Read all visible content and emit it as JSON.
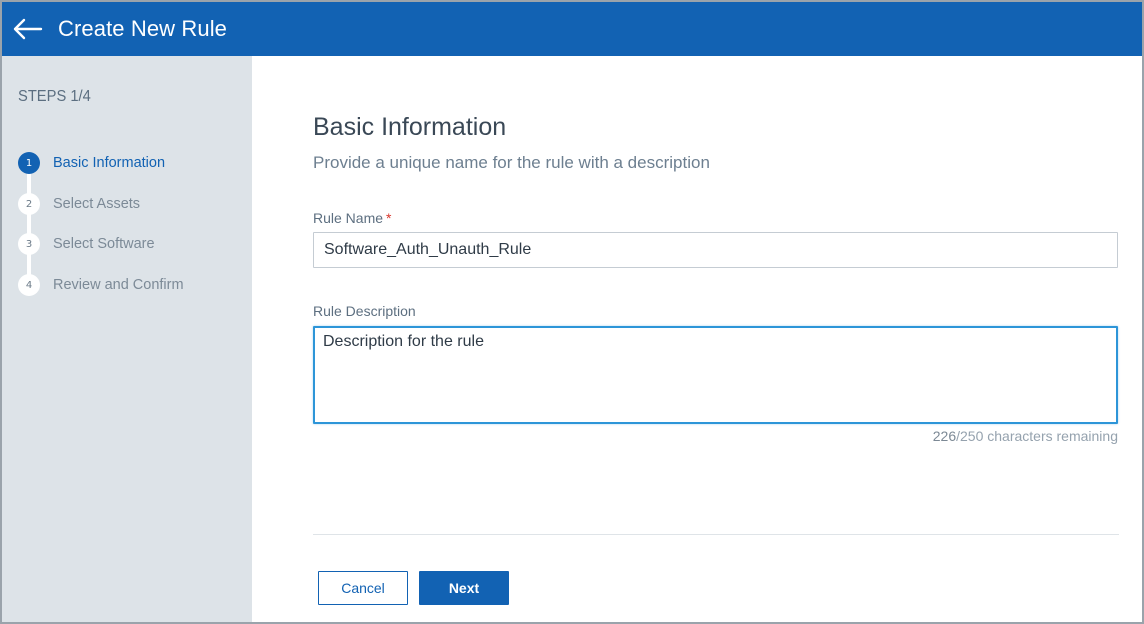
{
  "header": {
    "back_icon": "arrow-left-icon",
    "title": "Create New Rule"
  },
  "sidebar": {
    "steps_label": "STEPS 1/4",
    "steps": [
      {
        "number": "1",
        "label": "Basic Information",
        "active": true
      },
      {
        "number": "2",
        "label": "Select Assets",
        "active": false
      },
      {
        "number": "3",
        "label": "Select Software",
        "active": false
      },
      {
        "number": "4",
        "label": "Review and Confirm",
        "active": false
      }
    ]
  },
  "main": {
    "title": "Basic Information",
    "subtitle": "Provide a unique name for the rule with a description",
    "rule_name": {
      "label": "Rule Name",
      "required_mark": "*",
      "value": "Software_Auth_Unauth_Rule"
    },
    "rule_description": {
      "label": "Rule Description",
      "value": "Description for the rule",
      "remaining": "226",
      "max_suffix": "/250 characters remaining"
    },
    "buttons": {
      "cancel": "Cancel",
      "next": "Next"
    }
  },
  "colors": {
    "primary": "#1262b3",
    "sidebar_bg": "#dde3e8",
    "focus_border": "#2d95d8",
    "required": "#d9352b"
  }
}
